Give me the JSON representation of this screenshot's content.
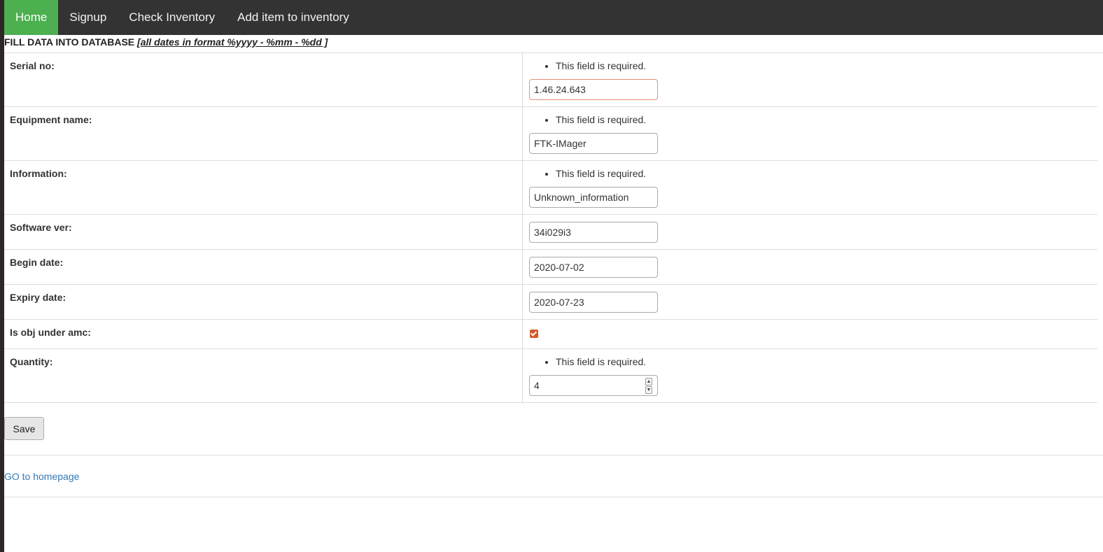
{
  "nav": {
    "items": [
      {
        "label": "Home"
      },
      {
        "label": "Signup"
      },
      {
        "label": "Check Inventory"
      },
      {
        "label": "Add item to inventory"
      }
    ]
  },
  "heading": {
    "title": "FILL DATA INTO DATABASE",
    "note": "[all dates in format %yyyy - %mm - %dd ]"
  },
  "fields": {
    "serial": {
      "label": "Serial no:",
      "error": "This field is required.",
      "value": "1.46.24.643"
    },
    "equipment": {
      "label": "Equipment name:",
      "error": "This field is required.",
      "value": "FTK-IMager"
    },
    "information": {
      "label": "Information:",
      "error": "This field is required.",
      "value": "Unknown_information"
    },
    "software": {
      "label": "Software ver:",
      "value": "34i029i3"
    },
    "begin": {
      "label": "Begin date:",
      "value": "2020-07-02"
    },
    "expiry": {
      "label": "Expiry date:",
      "value": "2020-07-23"
    },
    "amc": {
      "label": "Is obj under amc:",
      "checked": true
    },
    "quantity": {
      "label": "Quantity:",
      "error": "This field is required.",
      "value": "4"
    }
  },
  "actions": {
    "save_label": "Save"
  },
  "footer": {
    "home_link": "GO to homepage"
  },
  "colors": {
    "nav_bg": "#333333",
    "nav_active": "#4caf50",
    "link": "#337ab7",
    "checkbox": "#d65a2a"
  }
}
